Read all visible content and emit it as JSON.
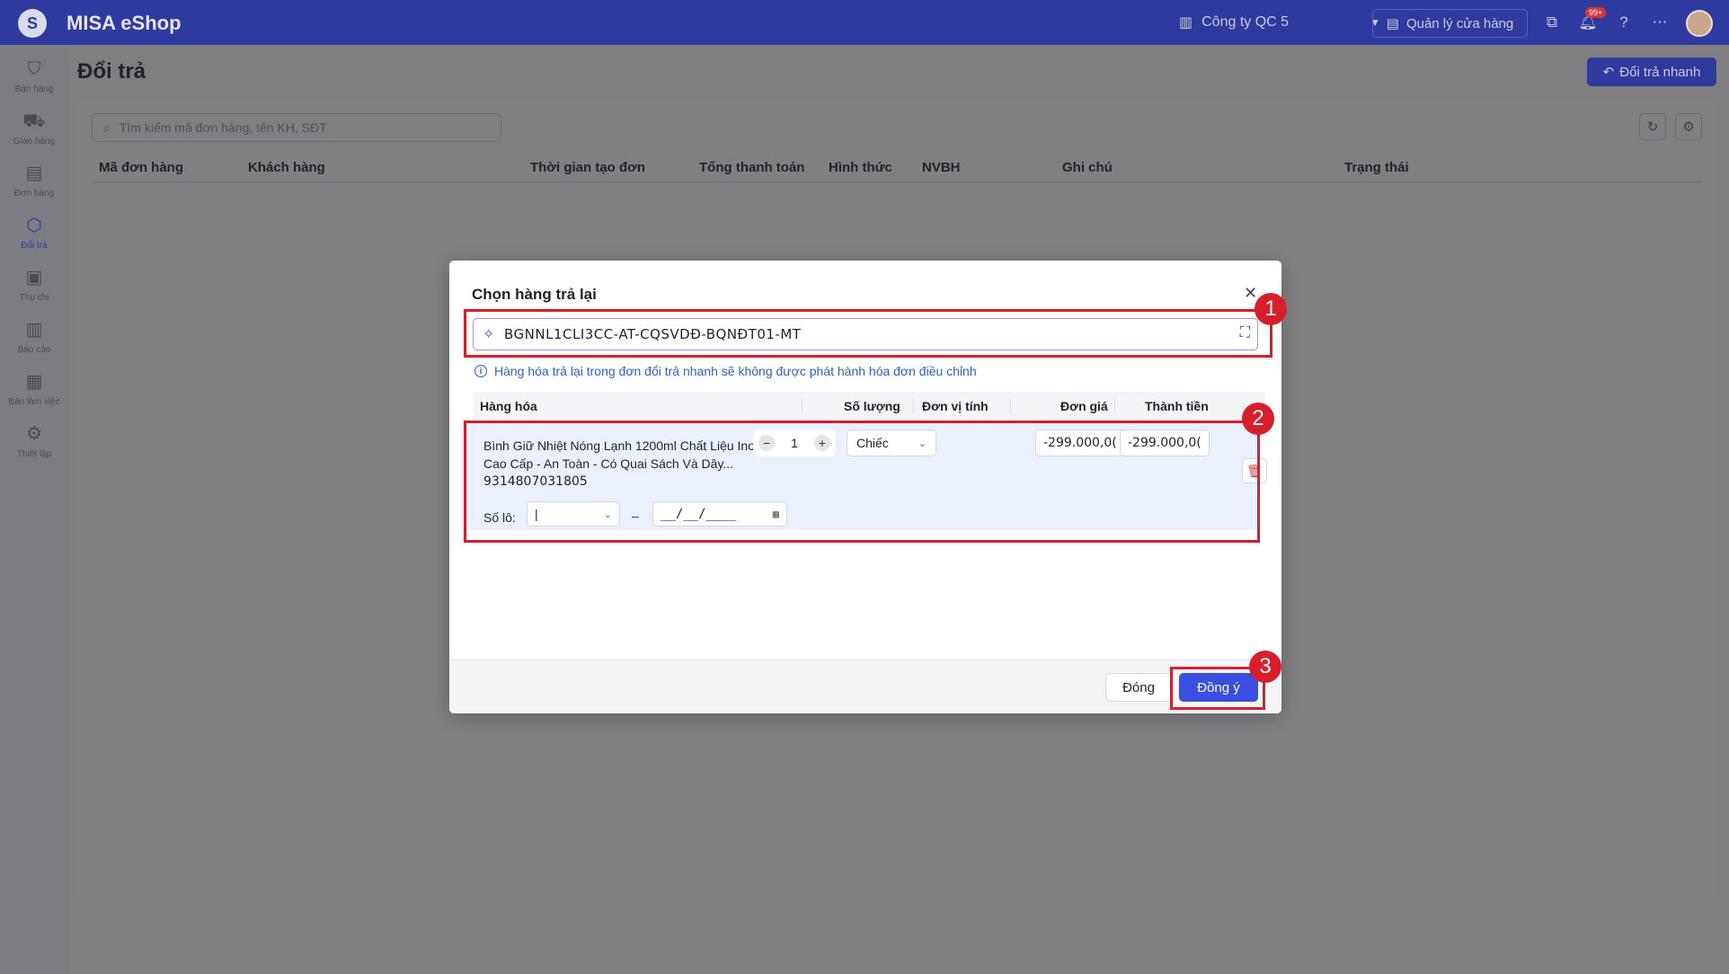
{
  "app": {
    "brand": "MISA eShop",
    "company": "Công ty QC 5",
    "store_button": "Quản lý cửa hàng",
    "notification_badge": "99+"
  },
  "sidebar": {
    "items": [
      {
        "label": "Bán hàng",
        "icon": "bag-icon"
      },
      {
        "label": "Giao hàng",
        "icon": "truck-icon"
      },
      {
        "label": "Đơn hàng",
        "icon": "clipboard-icon"
      },
      {
        "label": "Đổi trả",
        "icon": "return-box-icon"
      },
      {
        "label": "Thu chi",
        "icon": "cash-icon"
      },
      {
        "label": "Báo cáo",
        "icon": "chart-icon"
      },
      {
        "label": "Bàn làm việc",
        "icon": "grid-icon"
      },
      {
        "label": "Thiết lập",
        "icon": "gear-icon"
      }
    ]
  },
  "page": {
    "title": "Đổi trả",
    "quick_return_button": "Đổi trả nhanh",
    "search_placeholder": "Tìm kiếm mã đơn hàng, tên KH, SĐT",
    "columns": [
      "Mã đơn hàng",
      "Khách hàng",
      "Thời gian tạo đơn",
      "Tổng thanh toán",
      "Hình thức",
      "NVBH",
      "Ghi chú",
      "Trạng thái"
    ]
  },
  "modal": {
    "title": "Chọn hàng trả lại",
    "scan_value": "BGNNL1CLI3CC-AT-CQSVDĐ-BQNĐT01-MT",
    "info": "Hàng hóa trả lại trong đơn đổi trả nhanh sẽ không được phát hành hóa đơn điều chỉnh",
    "headers": {
      "item": "Hàng hóa",
      "qty": "Số lượng",
      "unit": "Đơn vị tính",
      "price": "Đơn giá",
      "total": "Thành tiền"
    },
    "row": {
      "name": "Bình Giữ Nhiệt Nóng Lạnh 1200ml Chất Liệu Inox 316 Cao Cấp - An Toàn - Có Quai Sách Và Dây...",
      "sku": "9314807031805",
      "qty": "1",
      "unit": "Chiếc",
      "price": "-299.000,0(",
      "total": "-299.000,0(",
      "lot_label": "Số lô:",
      "lot_value": "|",
      "expiry_placeholder": "__/__/____"
    },
    "close_button": "Đóng",
    "ok_button": "Đồng ý"
  },
  "annotations": {
    "step1": "1",
    "step2": "2",
    "step3": "3",
    "color": "#d81e2b"
  }
}
